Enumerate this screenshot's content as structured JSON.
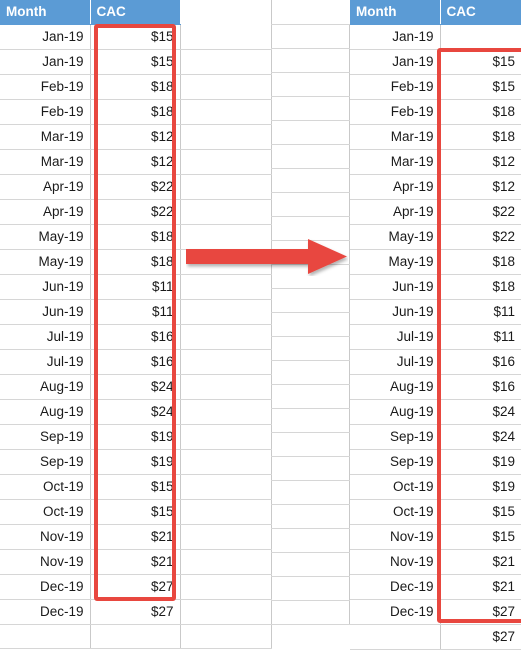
{
  "table_left": {
    "name": "source-table",
    "headers": [
      "Month",
      "CAC"
    ],
    "rows": [
      {
        "month": "Jan-19",
        "cac": "$15"
      },
      {
        "month": "Jan-19",
        "cac": "$15"
      },
      {
        "month": "Feb-19",
        "cac": "$18"
      },
      {
        "month": "Feb-19",
        "cac": "$18"
      },
      {
        "month": "Mar-19",
        "cac": "$12"
      },
      {
        "month": "Mar-19",
        "cac": "$12"
      },
      {
        "month": "Apr-19",
        "cac": "$22"
      },
      {
        "month": "Apr-19",
        "cac": "$22"
      },
      {
        "month": "May-19",
        "cac": "$18"
      },
      {
        "month": "May-19",
        "cac": "$18"
      },
      {
        "month": "Jun-19",
        "cac": "$11"
      },
      {
        "month": "Jun-19",
        "cac": "$11"
      },
      {
        "month": "Jul-19",
        "cac": "$16"
      },
      {
        "month": "Jul-19",
        "cac": "$16"
      },
      {
        "month": "Aug-19",
        "cac": "$24"
      },
      {
        "month": "Aug-19",
        "cac": "$24"
      },
      {
        "month": "Sep-19",
        "cac": "$19"
      },
      {
        "month": "Sep-19",
        "cac": "$19"
      },
      {
        "month": "Oct-19",
        "cac": "$15"
      },
      {
        "month": "Oct-19",
        "cac": "$15"
      },
      {
        "month": "Nov-19",
        "cac": "$21"
      },
      {
        "month": "Nov-19",
        "cac": "$21"
      },
      {
        "month": "Dec-19",
        "cac": "$27"
      },
      {
        "month": "Dec-19",
        "cac": "$27"
      },
      {
        "month": "",
        "cac": ""
      }
    ]
  },
  "table_right": {
    "name": "shifted-table",
    "headers": [
      "Month",
      "CAC"
    ],
    "rows": [
      {
        "month": "Jan-19",
        "cac": ""
      },
      {
        "month": "Jan-19",
        "cac": "$15"
      },
      {
        "month": "Feb-19",
        "cac": "$15"
      },
      {
        "month": "Feb-19",
        "cac": "$18"
      },
      {
        "month": "Mar-19",
        "cac": "$18"
      },
      {
        "month": "Mar-19",
        "cac": "$12"
      },
      {
        "month": "Apr-19",
        "cac": "$12"
      },
      {
        "month": "Apr-19",
        "cac": "$22"
      },
      {
        "month": "May-19",
        "cac": "$22"
      },
      {
        "month": "May-19",
        "cac": "$18"
      },
      {
        "month": "Jun-19",
        "cac": "$18"
      },
      {
        "month": "Jun-19",
        "cac": "$11"
      },
      {
        "month": "Jul-19",
        "cac": "$11"
      },
      {
        "month": "Jul-19",
        "cac": "$16"
      },
      {
        "month": "Aug-19",
        "cac": "$16"
      },
      {
        "month": "Aug-19",
        "cac": "$24"
      },
      {
        "month": "Sep-19",
        "cac": "$24"
      },
      {
        "month": "Sep-19",
        "cac": "$19"
      },
      {
        "month": "Oct-19",
        "cac": "$19"
      },
      {
        "month": "Oct-19",
        "cac": "$15"
      },
      {
        "month": "Nov-19",
        "cac": "$15"
      },
      {
        "month": "Nov-19",
        "cac": "$21"
      },
      {
        "month": "Dec-19",
        "cac": "$21"
      },
      {
        "month": "Dec-19",
        "cac": "$27"
      },
      {
        "month": "",
        "cac": "$27"
      }
    ]
  },
  "annotations": {
    "arrow_icon": "right-arrow-icon",
    "arrow_color": "#E8473F",
    "highlight_color": "#E8473F",
    "header_color": "#5B9BD5",
    "gridline_color": "#D6D6D6"
  }
}
